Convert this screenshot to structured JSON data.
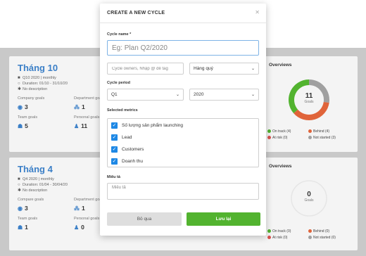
{
  "modal": {
    "title": "CREATE A NEW CYCLE",
    "close_icon": "close-icon",
    "cycle_name_label": "Cycle name *",
    "cycle_name_placeholder": "Eg: Plan Q2/2020",
    "owners_placeholder": "Cycle owners, Nhập @ để tag",
    "frequency_value": "Hàng quý",
    "cycle_period_label": "Cycle period",
    "period_value": "Q1",
    "year_value": "2020",
    "selected_metrics_label": "Selected metrics",
    "metrics": [
      {
        "label": "Số lượng sản phẩm launching",
        "checked": true
      },
      {
        "label": "Lead",
        "checked": true
      },
      {
        "label": "Customers",
        "checked": true
      },
      {
        "label": "Doanh thu",
        "checked": true
      }
    ],
    "description_label": "Miêu tả",
    "description_placeholder": "Miêu tả",
    "cancel_label": "Bỏ qua",
    "save_label": "Lưu lại"
  },
  "cycles": [
    {
      "title": "Tháng 10",
      "cycle_info": "Q10 2020 | monthly",
      "duration": "Duration: 01/10 - 31/10/20",
      "description": "No description",
      "company_goals_label": "Company goals",
      "company_goals": "3",
      "department_goals_label": "Department goa",
      "department_goals": "1",
      "team_goals_label": "Team goals",
      "team_goals": "5",
      "personal_goals_label": "Personal goals",
      "personal_goals": "11"
    },
    {
      "title": "Tháng 4",
      "cycle_info": "Q4 2020 | monthly",
      "duration": "Duration: 01/04 - 30/04/20",
      "description": "No description",
      "company_goals_label": "Compare goals",
      "company_goals": "3",
      "department_goals_label": "Department goa",
      "department_goals": "1",
      "team_goals_label": "Team goals",
      "team_goals": "1",
      "personal_goals_label": "Personal goals",
      "personal_goals": "0"
    }
  ],
  "overviews": [
    {
      "title": "Overviews",
      "total": "11",
      "total_label": "Goals",
      "on_track": "On track (4)",
      "behind": "Behind (4)",
      "at_risk": "At risk (0)",
      "not_started": "Not started (3)",
      "donut": {
        "on_track": 4,
        "behind": 4,
        "at_risk": 0,
        "not_started": 3
      }
    },
    {
      "title": "Overviews",
      "total": "0",
      "total_label": "Goals",
      "on_track": "On track (0)",
      "behind": "Behind (0)",
      "at_risk": "At risk (0)",
      "not_started": "Not started (0)",
      "donut": {
        "on_track": 0,
        "behind": 0,
        "at_risk": 0,
        "not_started": 0
      }
    }
  ],
  "colors": {
    "on_track": "#52b32f",
    "behind": "#e0643a",
    "at_risk": "#d9534f",
    "not_started": "#a0a0a0",
    "accent": "#1e88e5",
    "title_blue": "#3b7fc7"
  }
}
